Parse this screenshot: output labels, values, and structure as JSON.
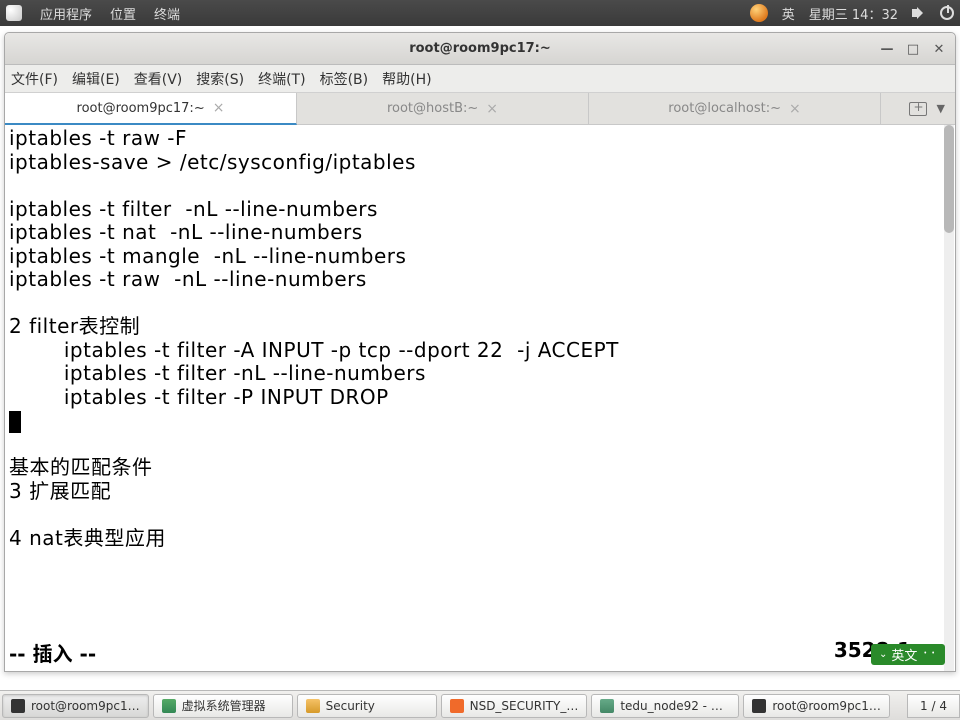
{
  "panel": {
    "menu_apps": "应用程序",
    "menu_places": "位置",
    "menu_terminal": "终端",
    "lang": "英",
    "clock": "星期三 14：32"
  },
  "window": {
    "title": "root@room9pc17:~",
    "menus": {
      "file": "文件(F)",
      "edit": "编辑(E)",
      "view": "查看(V)",
      "search": "搜索(S)",
      "terminal": "终端(T)",
      "tabs": "标签(B)",
      "help": "帮助(H)"
    },
    "tabs": [
      {
        "label": "root@room9pc17:~",
        "active": true
      },
      {
        "label": "root@hostB:~",
        "active": false
      },
      {
        "label": "root@localhost:~",
        "active": false
      }
    ]
  },
  "terminal_text": "iptables -t raw -F\niptables-save > /etc/sysconfig/iptables\n\niptables -t filter  -nL --line-numbers\niptables -t nat  -nL --line-numbers\niptables -t mangle  -nL --line-numbers\niptables -t raw  -nL --line-numbers\n\n2 filter表控制\n        iptables -t filter -A INPUT -p tcp --dport 22  -j ACCEPT\n        iptables -t filter -nL --line-numbers\n        iptables -t filter -P INPUT DROP\n",
  "terminal_rest": "\n\n基本的匹配条件\n3 扩展匹配\n\n4 nat表典型应用\n\n\n",
  "statusline": {
    "mode": "-- 插入 --",
    "pos": "3528,1"
  },
  "ime": {
    "label": "英文"
  },
  "taskbar": {
    "items": [
      {
        "label": "root@room9pc1…",
        "icon": "ico-term",
        "active": true
      },
      {
        "label": "虚拟系统管理器",
        "icon": "ico-vm",
        "active": false
      },
      {
        "label": "Security",
        "icon": "ico-folder",
        "active": false
      },
      {
        "label": "NSD_SECURITY_…",
        "icon": "ico-wps",
        "active": false
      },
      {
        "label": "tedu_node92 - Q…",
        "icon": "ico-qt",
        "active": false
      },
      {
        "label": "root@room9pc1…",
        "icon": "ico-term",
        "active": false
      }
    ],
    "workspace": "1 / 4"
  }
}
